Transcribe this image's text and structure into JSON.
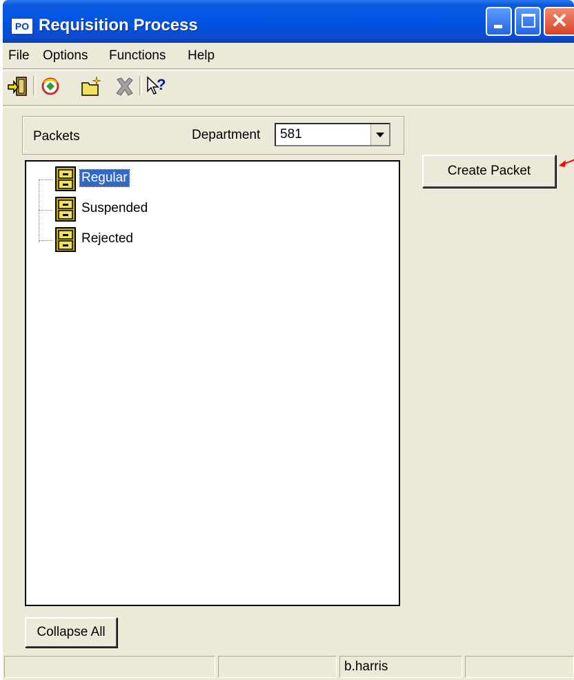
{
  "window": {
    "app_icon_text": "PO",
    "title": "Requisition Process",
    "titlebar_color": "#0054e3"
  },
  "menu": {
    "items": [
      {
        "label": "File"
      },
      {
        "label": "Options"
      },
      {
        "label": "Functions"
      },
      {
        "label": "Help"
      }
    ]
  },
  "toolbar": {
    "icons": [
      "exit-door-icon",
      "refresh-icon",
      "new-folder-icon",
      "delete-icon",
      "whats-this-help-icon"
    ]
  },
  "packets_panel": {
    "packets_label": "Packets",
    "department_label": "Department",
    "department_value": "581"
  },
  "tree": {
    "items": [
      {
        "label": "Regular",
        "selected": true
      },
      {
        "label": "Suspended",
        "selected": false
      },
      {
        "label": "Rejected",
        "selected": false
      }
    ]
  },
  "buttons": {
    "create_packet": "Create Packet",
    "collapse_all": "Collapse All"
  },
  "status_bar": {
    "cells": [
      "",
      "",
      "b.harris",
      ""
    ]
  },
  "colors": {
    "selection": "#316ac5",
    "window_bg": "#ece9d8",
    "annotation_arrow": "#ff0000"
  }
}
